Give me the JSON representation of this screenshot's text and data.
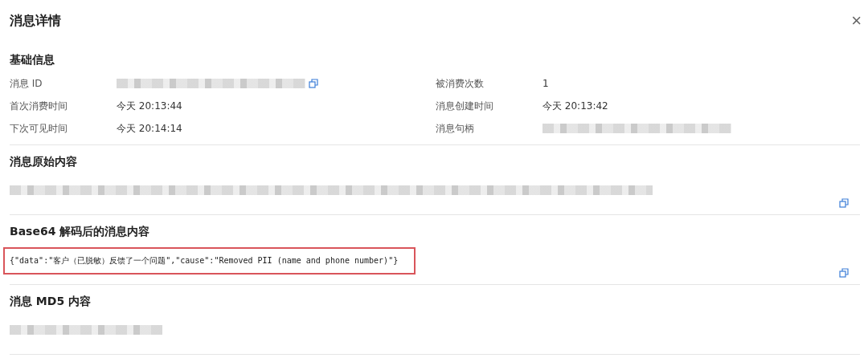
{
  "dialog": {
    "title": "消息详情",
    "close": "×"
  },
  "basic_info": {
    "heading": "基础信息",
    "fields": [
      {
        "label": "消息 ID",
        "kind": "redacted",
        "copyable": true
      },
      {
        "label": "被消费次数",
        "kind": "text",
        "value": "1",
        "copyable": false
      },
      {
        "label": "首次消费时间",
        "kind": "text",
        "value": "今天 20:13:44",
        "copyable": false
      },
      {
        "label": "消息创建时间",
        "kind": "text",
        "value": "今天 20:13:42",
        "copyable": false
      },
      {
        "label": "下次可见时间",
        "kind": "text",
        "value": "今天 20:14:14",
        "copyable": false
      },
      {
        "label": "消息句柄",
        "kind": "redacted",
        "copyable": false
      }
    ]
  },
  "sections": [
    {
      "heading": "消息原始内容",
      "kind": "redacted",
      "copyable": true,
      "highlighted": false
    },
    {
      "heading": "Base64 解码后的消息内容",
      "kind": "text",
      "value": "{\"data\":\"客户（已脱敏）反馈了一个问题\",\"cause\":\"Removed PII (name and phone number)\"}",
      "copyable": true,
      "highlighted": true
    },
    {
      "heading": "消息 MD5 内容",
      "kind": "redacted",
      "copyable": false,
      "highlighted": false
    }
  ]
}
